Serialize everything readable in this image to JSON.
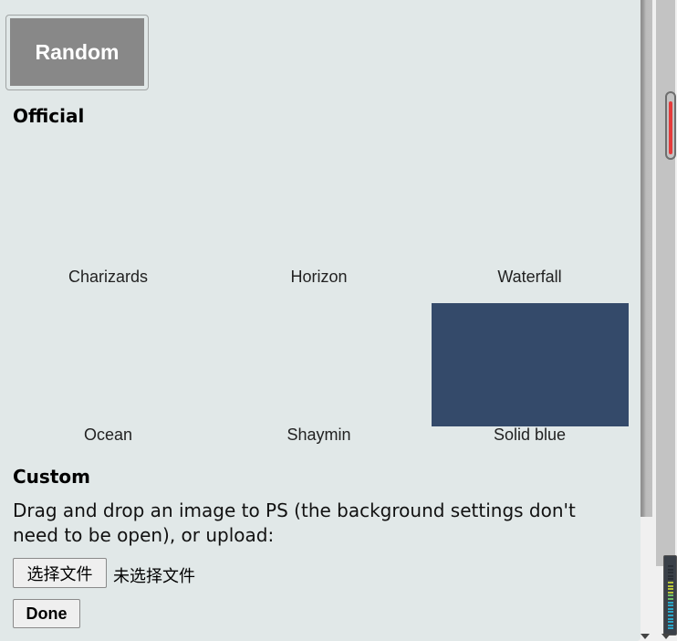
{
  "random_button": {
    "label": "Random"
  },
  "official": {
    "title": "Official",
    "backgrounds": [
      {
        "label": "Charizards",
        "swatch": null
      },
      {
        "label": "Horizon",
        "swatch": null
      },
      {
        "label": "Waterfall",
        "swatch": null
      },
      {
        "label": "Ocean",
        "swatch": null
      },
      {
        "label": "Shaymin",
        "swatch": null
      },
      {
        "label": "Solid blue",
        "swatch": "#344a6a"
      }
    ]
  },
  "custom": {
    "title": "Custom",
    "description": "Drag and drop an image to PS (the background settings don't need to be open), or upload:",
    "file_button_label": "选择文件",
    "file_status": "未选择文件",
    "done_label": "Done"
  },
  "colors": {
    "panel_bg": "#e1e8e8",
    "random_bg": "#888888",
    "scroll_thumb_accent": "#e53b3b"
  }
}
